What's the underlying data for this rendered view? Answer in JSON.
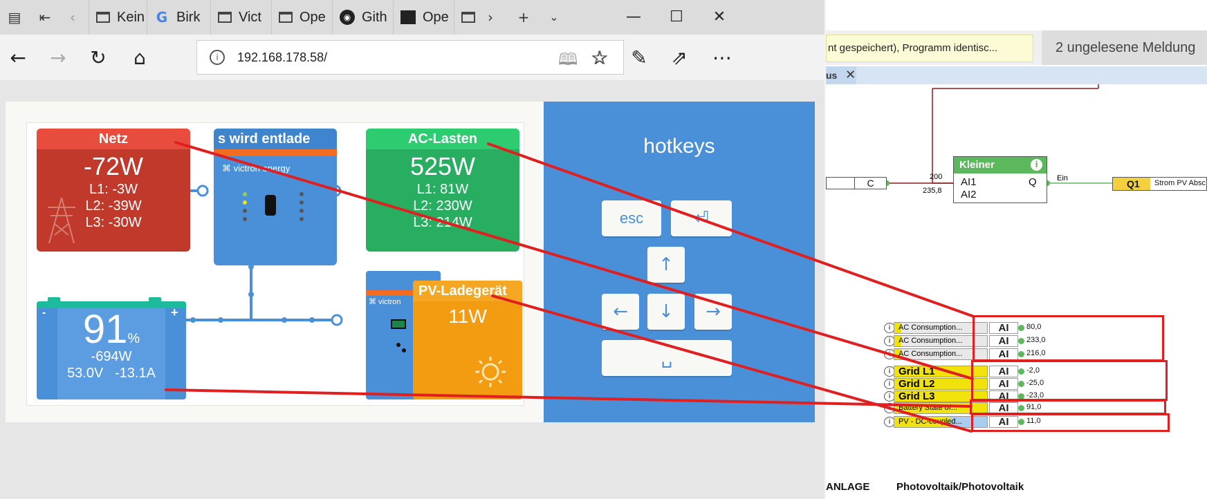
{
  "browser": {
    "tabs": [
      {
        "label": "Kein",
        "icon": "page-icon"
      },
      {
        "label": "Birk",
        "icon": "google-icon"
      },
      {
        "label": "Vict",
        "icon": "page-icon"
      },
      {
        "label": "Ope",
        "icon": "page-icon"
      },
      {
        "label": "Gith",
        "icon": "github-icon"
      },
      {
        "label": "Ope",
        "icon": "dark-site-icon"
      }
    ],
    "url": "192.168.178.58/"
  },
  "diagram": {
    "grid": {
      "title": "Netz",
      "power": "-72W",
      "l1": "L1: -3W",
      "l2": "L2: -39W",
      "l3": "L3: -30W"
    },
    "inverter": {
      "title": "s wird entlade",
      "brand": "victron energy"
    },
    "ac_loads": {
      "title": "AC-Lasten",
      "power": "525W",
      "l1": "L1: 81W",
      "l2": "L2: 230W",
      "l3": "L3: 214W"
    },
    "battery": {
      "soc": "91",
      "soc_unit": "%",
      "power": "-694W",
      "voltage": "53.0V",
      "current": "-13.1A",
      "minus": "-",
      "plus": "+"
    },
    "mppt": {
      "brand": "victron"
    },
    "pv_charger": {
      "title": "PV-Ladegerät",
      "power": "11W"
    }
  },
  "hotkeys": {
    "title": "hotkeys",
    "keys": {
      "esc": "esc",
      "enter": "⏎",
      "up": "↑",
      "left": "←",
      "down": "↓",
      "right": "→",
      "space": "␣"
    }
  },
  "app": {
    "message": "nt gespeichert), Programm identisc...",
    "notification": "2 ungelesene Meldung",
    "tab_label": "us",
    "c_block": "C",
    "kleiner": {
      "title": "Kleiner",
      "in1": "AI1",
      "in2": "AI2",
      "out": "Q",
      "val1": "200",
      "val2": "235,8",
      "out_label": "Ein"
    },
    "q1": {
      "label": "Q1",
      "text": "Strom PV Absc"
    },
    "rows": [
      {
        "name": "AC Consumption...",
        "type": "AI",
        "value": "80,0"
      },
      {
        "name": "AC Consumption...",
        "type": "AI",
        "value": "233,0"
      },
      {
        "name": "AC Consumption...",
        "type": "AI",
        "value": "216,0"
      },
      {
        "name": "Grid L1",
        "type": "AI",
        "value": "-2,0"
      },
      {
        "name": "Grid L2",
        "type": "AI",
        "value": "-25,0"
      },
      {
        "name": "Grid L3",
        "type": "AI",
        "value": "-23,0"
      },
      {
        "name": "Battery State of...",
        "type": "AI",
        "value": "91,0"
      },
      {
        "name": "PV - DC-coupled...",
        "type": "AI",
        "value": "11,0"
      }
    ],
    "footer_left": "ANLAGE",
    "footer_right": "Photovoltaik/Photovoltaik"
  },
  "colors": {
    "grid": "#c0392b",
    "ac": "#27ae60",
    "inverter": "#4a90d9",
    "pv": "#f39c12",
    "annotation": "#e02020"
  }
}
